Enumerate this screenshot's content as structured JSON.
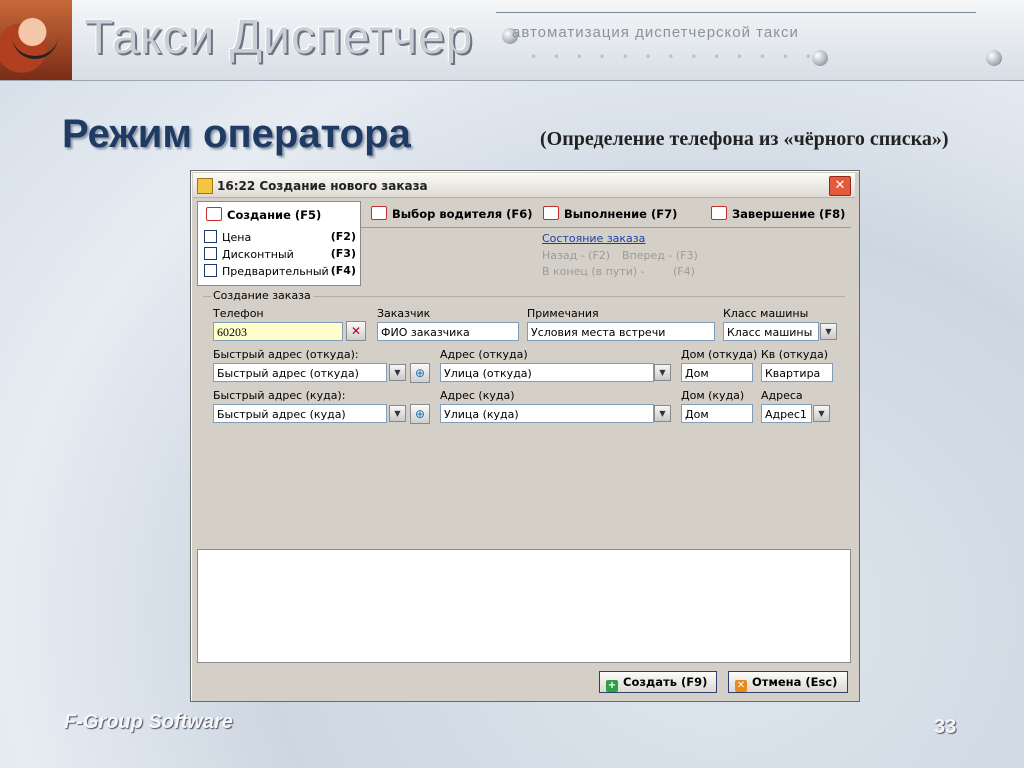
{
  "banner": {
    "brand": "Такси Диспетчер",
    "slogan": "автоматизация диспетчерской такси"
  },
  "slide": {
    "title": "Режим оператора",
    "subtitle": "(Определение телефона из «чёрного списка»)",
    "footer": "F-Group Software",
    "page": "33"
  },
  "window": {
    "title": "16:22 Создание нового заказа",
    "close": "✕"
  },
  "tabs": [
    {
      "label": "Создание (F5)"
    },
    {
      "label": "Выбор водителя (F6)"
    },
    {
      "label": "Выполнение (F7)"
    },
    {
      "label": "Завершение (F8)"
    }
  ],
  "options": [
    {
      "label": "Цена",
      "key": "(F2)"
    },
    {
      "label": "Дисконтный",
      "key": "(F3)"
    },
    {
      "label": "Предварительный",
      "key": "(F4)"
    }
  ],
  "status": {
    "link": "Состояние заказа",
    "back": "Назад - (F2)",
    "forward": "Вперед - (F3)",
    "to_end": "В конец (в пути) -",
    "to_end_key": "(F4)"
  },
  "form": {
    "group_label": "Создание заказа",
    "phone_label": "Телефон",
    "phone_value": "60203",
    "customer_label": "Заказчик",
    "customer_value": "ФИО заказчика",
    "notes_label": "Примечания",
    "notes_value": "Условия места встречи",
    "car_class_label": "Класс машины",
    "car_class_value": "Класс машины",
    "quick_from_label": "Быстрый адрес (откуда):",
    "quick_from_value": "Быстрый адрес (откуда)",
    "addr_from_label": "Адрес (откуда)",
    "addr_from_value": "Улица (откуда)",
    "house_from_label": "Дом (откуда)",
    "house_from_value": "Дом",
    "apt_from_label": "Кв (откуда)",
    "apt_from_value": "Квартира",
    "quick_to_label": "Быстрый адрес (куда):",
    "quick_to_value": "Быстрый адрес (куда)",
    "addr_to_label": "Адрес (куда)",
    "addr_to_value": "Улица (куда)",
    "house_to_label": "Дом (куда)",
    "house_to_value": "Дом",
    "addresses_label": "Адреса",
    "addresses_value": "Адрес1"
  },
  "buttons": {
    "create": "Создать (F9)",
    "cancel": "Отмена (Esc)"
  },
  "colors": {
    "title": "#1f3a63",
    "link": "#1a3fa8",
    "phone_bg": "#ffffcc",
    "create_icon": "#2f9e44",
    "cancel_icon": "#e8891d"
  },
  "icons": {
    "tab": "form-icon",
    "blacklist": "blacklist-x-icon",
    "add_address": "globe-add-icon",
    "dropdown": "chevron-down-icon"
  }
}
